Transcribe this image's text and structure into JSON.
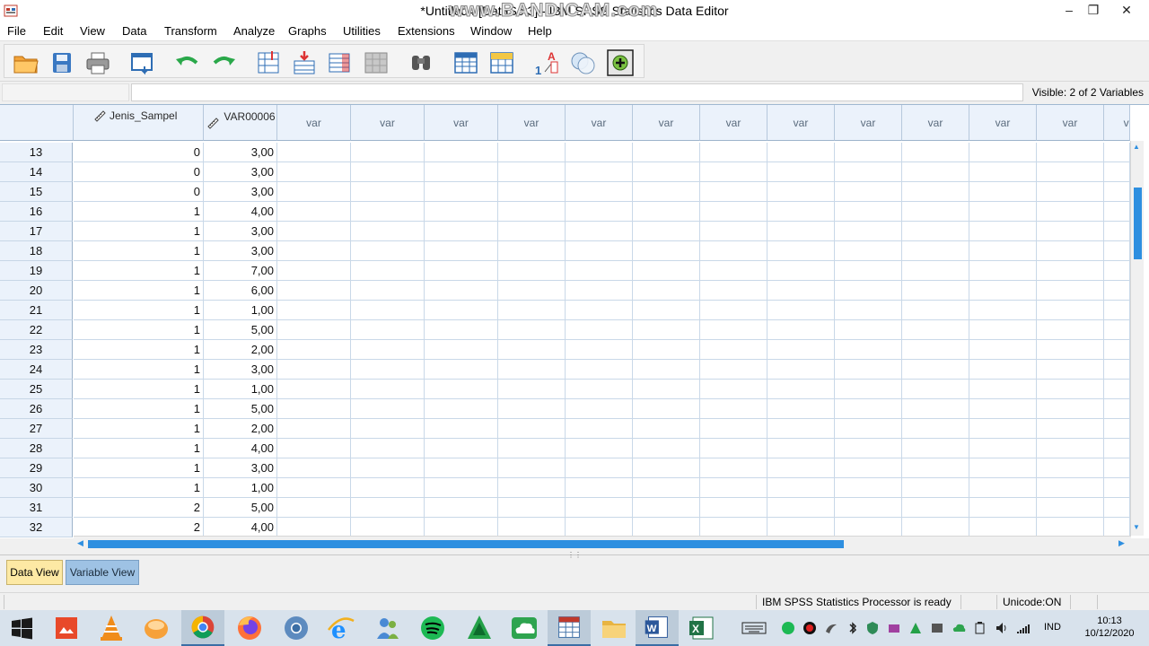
{
  "window": {
    "title": "*Untitled4 [DataSet3] - IBM SPSS Statistics Data Editor",
    "watermark": "www.BANDICAM.com"
  },
  "menu": [
    "File",
    "Edit",
    "View",
    "Data",
    "Transform",
    "Analyze",
    "Graphs",
    "Utilities",
    "Extensions",
    "Window",
    "Help"
  ],
  "infobar": {
    "cell_ref": "",
    "cell_value": "",
    "visible": "Visible: 2 of 2 Variables"
  },
  "grid": {
    "columns": [
      "Jenis_Sampel",
      "VAR00006",
      "var",
      "var",
      "var",
      "var",
      "var",
      "var",
      "var",
      "var",
      "var",
      "var",
      "var",
      "var",
      "var"
    ],
    "rows": [
      {
        "n": "13",
        "a": "0",
        "b": "3,00"
      },
      {
        "n": "14",
        "a": "0",
        "b": "3,00"
      },
      {
        "n": "15",
        "a": "0",
        "b": "3,00"
      },
      {
        "n": "16",
        "a": "1",
        "b": "4,00"
      },
      {
        "n": "17",
        "a": "1",
        "b": "3,00"
      },
      {
        "n": "18",
        "a": "1",
        "b": "3,00"
      },
      {
        "n": "19",
        "a": "1",
        "b": "7,00"
      },
      {
        "n": "20",
        "a": "1",
        "b": "6,00"
      },
      {
        "n": "21",
        "a": "1",
        "b": "1,00"
      },
      {
        "n": "22",
        "a": "1",
        "b": "5,00"
      },
      {
        "n": "23",
        "a": "1",
        "b": "2,00"
      },
      {
        "n": "24",
        "a": "1",
        "b": "3,00"
      },
      {
        "n": "25",
        "a": "1",
        "b": "1,00"
      },
      {
        "n": "26",
        "a": "1",
        "b": "5,00"
      },
      {
        "n": "27",
        "a": "1",
        "b": "2,00"
      },
      {
        "n": "28",
        "a": "1",
        "b": "4,00"
      },
      {
        "n": "29",
        "a": "1",
        "b": "3,00"
      },
      {
        "n": "30",
        "a": "1",
        "b": "1,00"
      },
      {
        "n": "31",
        "a": "2",
        "b": "5,00"
      },
      {
        "n": "32",
        "a": "2",
        "b": "4,00"
      }
    ]
  },
  "tabs": {
    "data_view": "Data View",
    "variable_view": "Variable View"
  },
  "status": {
    "processor": "IBM SPSS Statistics Processor is ready",
    "unicode": "Unicode:ON"
  },
  "taskbar": {
    "lang": "IND",
    "time": "10:13",
    "date": "10/12/2020"
  },
  "colors": {
    "header_bg": "#ebf2fb",
    "active_tab": "#fde9a4",
    "inactive_tab": "#9ec2e4",
    "scroll_thumb": "#2e8fe0"
  }
}
